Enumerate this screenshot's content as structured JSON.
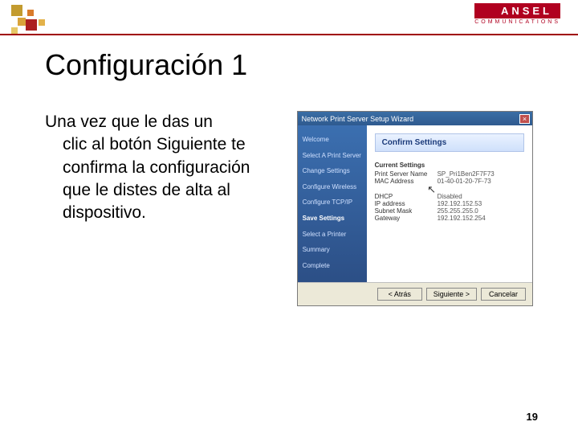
{
  "brand": {
    "name": "ANSEL",
    "tagline": "COMMUNICATIONS"
  },
  "slide": {
    "title": "Configuración 1",
    "body_line1": "Una vez que le das un",
    "body_rest": "clic al botón Siguiente te confirma la configuración que le distes de alta al dispositivo.",
    "page_number": "19"
  },
  "wizard": {
    "titlebar": "Network Print Server Setup Wizard",
    "close_label": "×",
    "panel_heading": "Confirm Settings",
    "steps": [
      "Welcome",
      "Select A Print Server",
      "Change Settings",
      "Configure Wireless",
      "Configure TCP/IP",
      "Save Settings",
      "Select a Printer",
      "Summary",
      "Complete"
    ],
    "active_step_index": 5,
    "current_settings_label": "Current Settings",
    "rows1": [
      {
        "k": "Print Server Name",
        "v": "SP_Pri1Ben2F7F73"
      },
      {
        "k": "MAC Address",
        "v": "01-40-01-20-7F-73"
      }
    ],
    "rows2": [
      {
        "k": "DHCP",
        "v": "Disabled"
      },
      {
        "k": "IP address",
        "v": "192.192.152.53"
      },
      {
        "k": "Subnet Mask",
        "v": "255.255.255.0"
      },
      {
        "k": "Gateway",
        "v": "192.192.152.254"
      }
    ],
    "buttons": {
      "back": "< Atrás",
      "next": "Siguiente >",
      "cancel": "Cancelar"
    }
  }
}
